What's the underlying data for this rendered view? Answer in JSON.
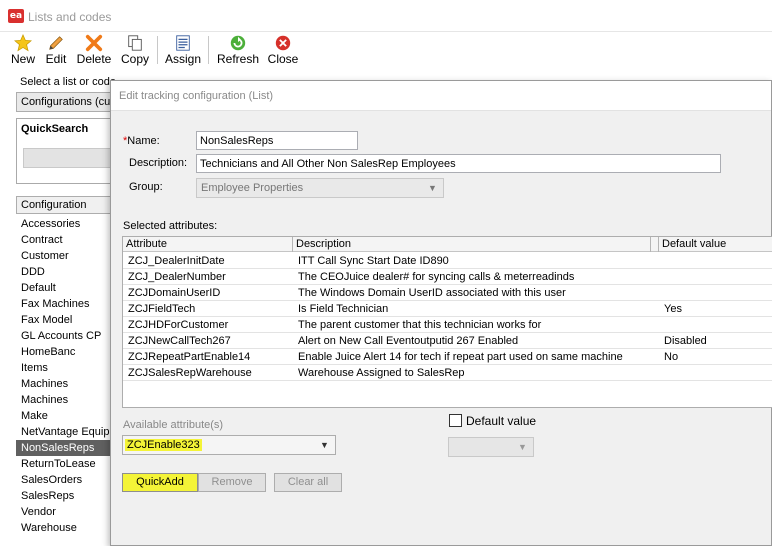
{
  "window": {
    "logo": "ea",
    "title": "Lists and codes"
  },
  "toolbar": {
    "new_label": "New",
    "edit_label": "Edit",
    "delete_label": "Delete",
    "copy_label": "Copy",
    "assign_label": "Assign",
    "refresh_label": "Refresh",
    "close_label": "Close"
  },
  "left_panel": {
    "select_label": "Select a list or code",
    "config_combo": "Configurations (cus",
    "quicksearch_title": "QuickSearch",
    "list_header": "Configuration",
    "items": [
      "Accessories",
      "Contract",
      "Customer",
      "DDD",
      "Default",
      "Fax Machines",
      "Fax Model",
      "GL Accounts CP",
      "HomeBanc",
      "Items",
      "Machines",
      "Machines",
      "Make",
      "NetVantage Equipm",
      "NonSalesReps",
      "ReturnToLease",
      "SalesOrders",
      "SalesReps",
      "Vendor",
      "Warehouse"
    ],
    "selected_item": "NonSalesReps"
  },
  "dialog": {
    "title": "Edit tracking configuration (List)",
    "name_required_mark": "*",
    "name_label": "Name:",
    "name_value": "NonSalesReps",
    "description_label": "Description:",
    "description_value": "Technicians and All Other Non SalesRep Employees",
    "group_label": "Group:",
    "group_value": "Employee Properties",
    "selected_attributes_label": "Selected attributes:",
    "grid_headers": {
      "attribute": "Attribute",
      "description": "Description",
      "default_value": "Default value"
    },
    "rows": [
      {
        "attribute": "ZCJ_DealerInitDate",
        "description": "ITT Call Sync Start Date ID890",
        "default": ""
      },
      {
        "attribute": "ZCJ_DealerNumber",
        "description": "The CEOJuice dealer# for syncing calls & meterreadinds",
        "default": ""
      },
      {
        "attribute": "ZCJDomainUserID",
        "description": "The Windows Domain UserID associated with this user",
        "default": ""
      },
      {
        "attribute": "ZCJFieldTech",
        "description": "Is Field Technician",
        "default": "Yes"
      },
      {
        "attribute": "ZCJHDForCustomer",
        "description": "The parent customer that this technician works for",
        "default": ""
      },
      {
        "attribute": "ZCJNewCallTech267",
        "description": "Alert on New Call Eventoutputid 267 Enabled",
        "default": "Disabled"
      },
      {
        "attribute": "ZCJRepeatPartEnable14",
        "description": "Enable Juice Alert 14 for tech if repeat part used on same machine",
        "default": "No"
      },
      {
        "attribute": "ZCJSalesRepWarehouse",
        "description": "Warehouse Assigned to SalesRep",
        "default": ""
      }
    ],
    "available_label": "Available attribute(s)",
    "available_value": "ZCJEnable323",
    "default_value_label": "Default value",
    "default_value_checked": false,
    "quickadd_label": "QuickAdd",
    "remove_label": "Remove",
    "clear_all_label": "Clear all",
    "highlight_color": "#f4f437"
  }
}
